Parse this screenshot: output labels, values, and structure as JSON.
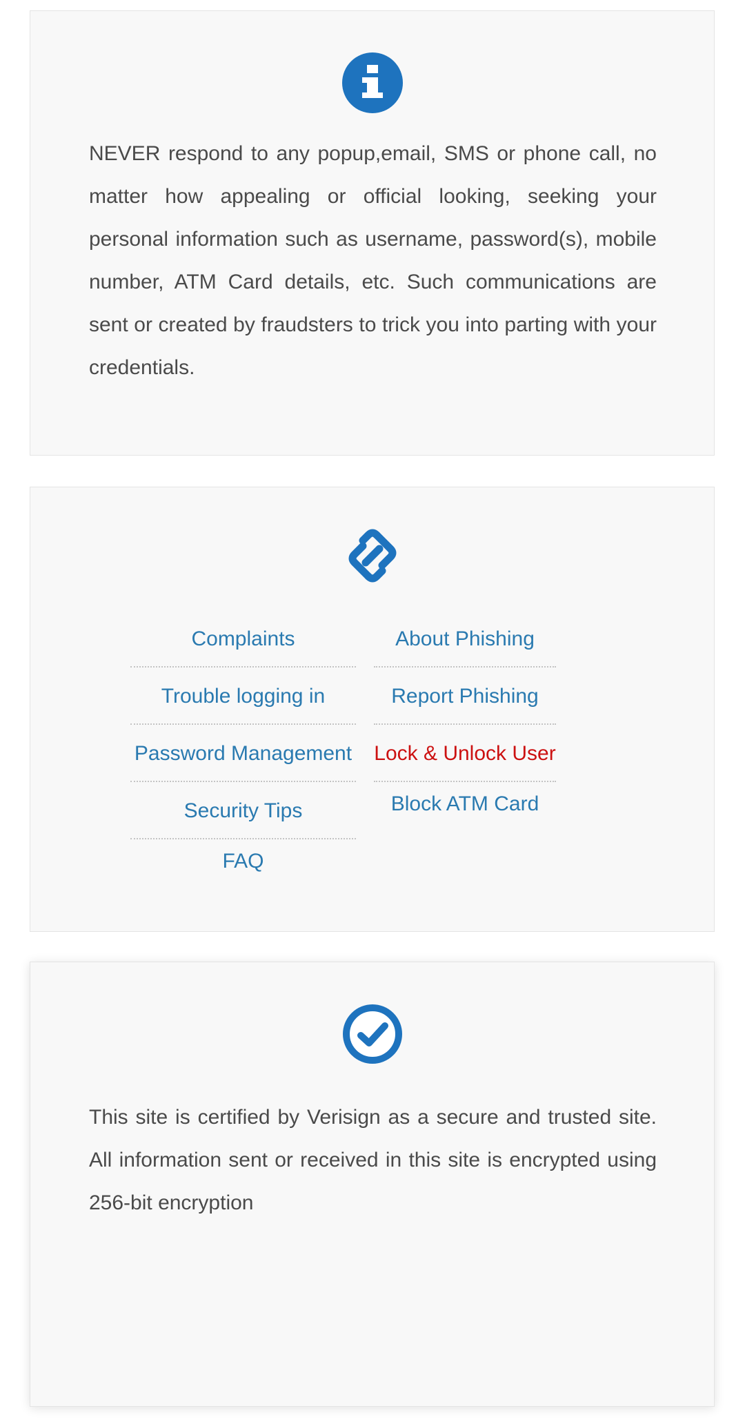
{
  "info_card": {
    "icon": "info-icon",
    "text": "NEVER respond to any popup,email, SMS or phone call, no matter how appealing or official looking, seeking your personal information such as username, password(s), mobile number, ATM Card details, etc. Such communications are sent or created by fraudsters to trick you into parting with your credentials."
  },
  "links_card": {
    "icon": "link-icon",
    "left_links": [
      {
        "label": "Complaints"
      },
      {
        "label": "Trouble logging in"
      },
      {
        "label": "Password Management"
      },
      {
        "label": "Security Tips"
      },
      {
        "label": "FAQ"
      }
    ],
    "right_links": [
      {
        "label": "About Phishing"
      },
      {
        "label": "Report Phishing"
      },
      {
        "label": "Lock & Unlock User"
      },
      {
        "label": "Block ATM Card"
      }
    ]
  },
  "secure_card": {
    "icon": "check-circle-icon",
    "text": "This site is certified by Verisign as a secure and trusted site. All information sent or received in this site is encrypted using 256-bit encryption"
  },
  "colors": {
    "accent": "#1e73be",
    "link": "#2a7ab0",
    "alert_link": "#cc1111",
    "body_text": "#4a4a4a",
    "card_bg": "#f8f8f8"
  }
}
